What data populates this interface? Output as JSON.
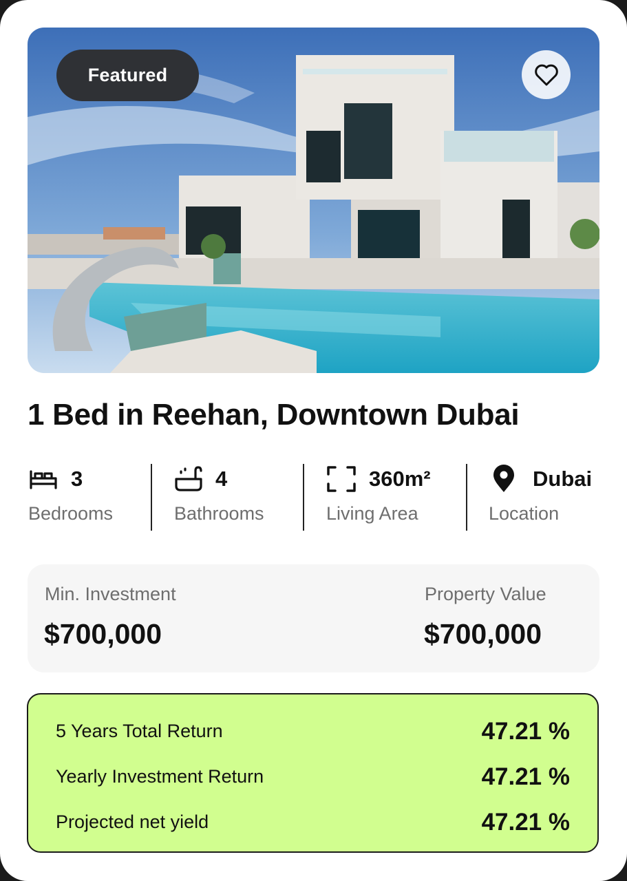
{
  "listing": {
    "badge": "Featured",
    "title": "1 Bed in Reehan, Downtown Dubai"
  },
  "stats": [
    {
      "icon": "bed-icon",
      "value": "3",
      "label": "Bedrooms"
    },
    {
      "icon": "bathtub-icon",
      "value": "4",
      "label": "Bathrooms"
    },
    {
      "icon": "area-frame-icon",
      "value": "360m²",
      "label": "Living Area"
    },
    {
      "icon": "location-pin-icon",
      "value": "Dubai",
      "label": "Location"
    }
  ],
  "investment": {
    "min_label": "Min. Investment",
    "min_value": "$700,000",
    "property_label": "Property Value",
    "property_value": "$700,000"
  },
  "returns": [
    {
      "label": "5 Years Total Return",
      "value": "47.21 %"
    },
    {
      "label": "Yearly Investment Return",
      "value": "47.21 %"
    },
    {
      "label": "Projected net yield",
      "value": "47.21 %"
    }
  ],
  "colors": {
    "badge_bg": "#2f3135",
    "returns_bg": "#d1fe8f",
    "invest_bg": "#f6f6f6"
  }
}
